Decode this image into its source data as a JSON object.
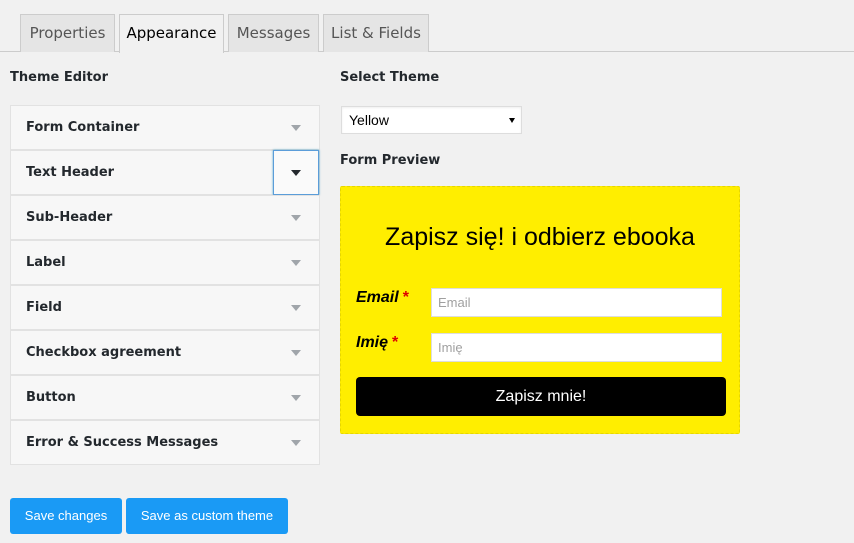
{
  "tabs": [
    {
      "label": "Properties"
    },
    {
      "label": "Appearance",
      "active": true
    },
    {
      "label": "Messages"
    },
    {
      "label": "List & Fields"
    }
  ],
  "theme_editor": {
    "title": "Theme Editor",
    "items": [
      {
        "label": "Form Container"
      },
      {
        "label": "Text Header",
        "focused": true
      },
      {
        "label": "Sub-Header"
      },
      {
        "label": "Label"
      },
      {
        "label": "Field"
      },
      {
        "label": "Checkbox agreement"
      },
      {
        "label": "Button"
      },
      {
        "label": "Error & Success Messages"
      }
    ]
  },
  "select_theme": {
    "title": "Select Theme",
    "value": "Yellow"
  },
  "form_preview": {
    "title": "Form Preview",
    "background": "#ffee00",
    "heading": "Zapisz się! i odbierz ebooka",
    "fields": [
      {
        "label": "Email",
        "required_mark": "*",
        "placeholder": "Email"
      },
      {
        "label": "Imię",
        "required_mark": "*",
        "placeholder": "Imię"
      }
    ],
    "submit_label": "Zapisz mnie!"
  },
  "actions": {
    "save_label": "Save changes",
    "save_custom_label": "Save as custom theme"
  },
  "colors": {
    "primary_button": "#1a9af5",
    "preview_button": "#000000",
    "required": "#dd0000"
  }
}
